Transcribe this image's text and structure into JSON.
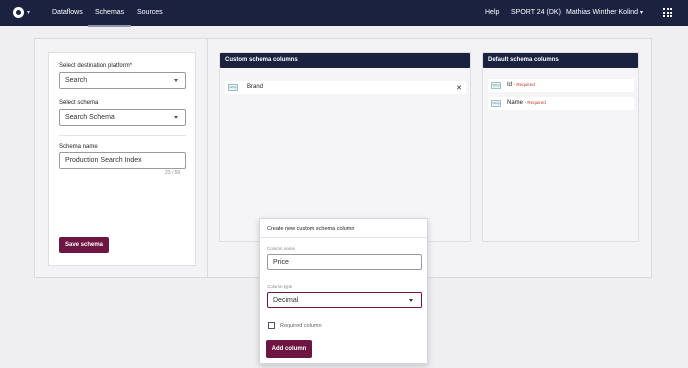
{
  "nav": {
    "items": [
      {
        "label": "Dataflows"
      },
      {
        "label": "Schemas"
      },
      {
        "label": "Sources"
      }
    ],
    "help": "Help",
    "account": "SPORT 24 (DK)",
    "user": "Mathias Winther Kolind"
  },
  "left": {
    "platform_label": "Select destination platform*",
    "platform_value": "Search",
    "schema_label": "Select schema",
    "schema_value": "Search Schema",
    "name_label": "Schema name",
    "name_value": "Production Search Index",
    "counter": "23 / 50",
    "save_label": "Save schema"
  },
  "custom": {
    "header": "Custom schema columns",
    "items": [
      {
        "type": "string",
        "name": "Brand"
      }
    ]
  },
  "default": {
    "header": "Default schema columns",
    "items": [
      {
        "type": "string",
        "name": "Id",
        "required": "- Required"
      },
      {
        "type": "string",
        "name": "Name",
        "required": "- Required"
      }
    ]
  },
  "modal": {
    "title": "Create new custom schema column",
    "column_name_label": "Column name",
    "column_name_value": "Price",
    "column_type_label": "Column type",
    "column_type_value": "Decimal",
    "required_label": "Required column",
    "add_label": "Add column"
  },
  "colors": {
    "navy": "#1b2240",
    "accent": "#6e1642",
    "required": "#c0392b"
  },
  "icons": {
    "logo": "brand-logo-icon",
    "apps": "apps-grid-icon",
    "close": "close-icon",
    "caret": "chevron-down-icon"
  }
}
